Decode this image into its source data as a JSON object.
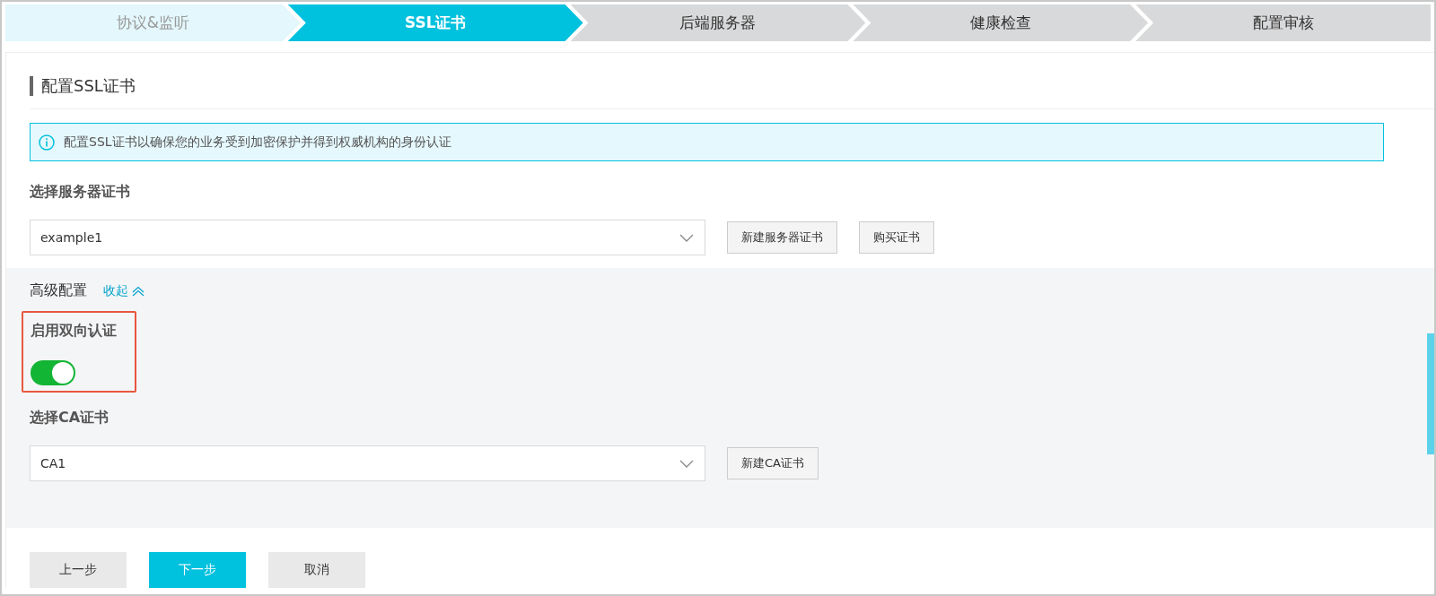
{
  "steps": [
    {
      "label": "协议&监听",
      "selected": false,
      "kind": "completed"
    },
    {
      "label": "SSL证书",
      "selected": true,
      "kind": "current"
    },
    {
      "label": "后端服务器",
      "selected": false,
      "kind": "pending"
    },
    {
      "label": "健康检查",
      "selected": false,
      "kind": "pending"
    },
    {
      "label": "配置审核",
      "selected": false,
      "kind": "pending"
    }
  ],
  "section_title": "配置SSL证书",
  "info": "配置SSL证书以确保您的业务受到加密保护并得到权威机构的身份认证",
  "server_cert": {
    "label": "选择服务器证书",
    "value": "example1",
    "buttons": [
      "新建服务器证书",
      "购买证书"
    ]
  },
  "advanced": {
    "title": "高级配置",
    "toggle_link": "收起",
    "expanded": true,
    "mutual_auth": {
      "label": "启用双向认证",
      "on": true,
      "highlighted": true
    },
    "ca_cert": {
      "label": "选择CA证书",
      "value": "CA1",
      "buttons": [
        "新建CA证书"
      ]
    }
  },
  "footer_buttons": [
    {
      "label": "上一步",
      "kind": "secondary"
    },
    {
      "label": "下一步",
      "kind": "primary"
    },
    {
      "label": "取消",
      "kind": "secondary"
    }
  ]
}
